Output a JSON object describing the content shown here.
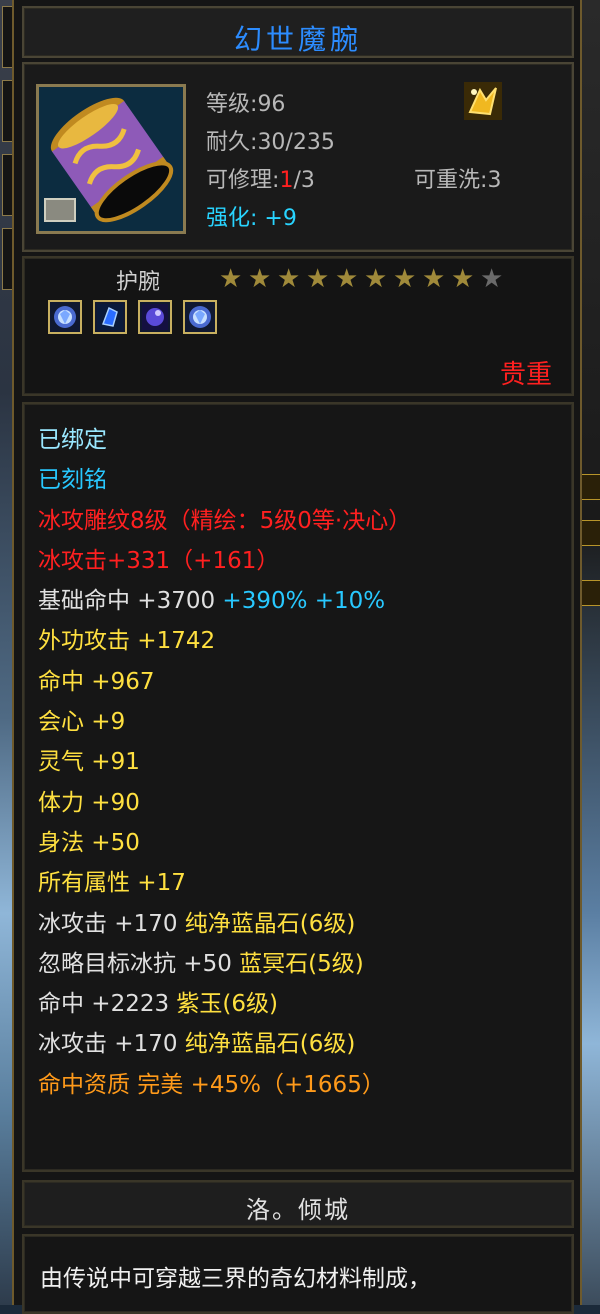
{
  "item": {
    "name": "幻世魔腕",
    "level_label": "等级",
    "level_value": "96",
    "durability_label": "耐久",
    "durability_value": "30/235",
    "repairable_label": "可修理",
    "repairable_current": "1",
    "repairable_total": "/3",
    "rewash_label": "可重洗",
    "rewash_value": "3",
    "enhance_label": "强化",
    "enhance_value": "+9",
    "type": "护腕",
    "stars_filled": 9,
    "stars_total": 10,
    "gems": [
      "ice-gem-icon",
      "blue-crystal-gem-icon",
      "purple-jade-gem-icon",
      "ice-gem-icon"
    ],
    "precious": "贵重"
  },
  "attributes": [
    {
      "text": "已绑定",
      "color": "lightblue"
    },
    {
      "text": "已刻铭",
      "color": "cyan"
    },
    {
      "text": "冰攻雕纹8级（精绘：5级0等·决心）",
      "color": "red"
    },
    {
      "text": "冰攻击+331（+161）",
      "color": "red"
    },
    {
      "text": "基础命中 +3700",
      "extra": " +390% +10%",
      "color": "white",
      "extra_color": "cyan"
    },
    {
      "text": "外功攻击 +1742",
      "color": "yellow"
    },
    {
      "text": "命中 +967",
      "color": "yellow"
    },
    {
      "text": "会心 +9",
      "color": "yellow"
    },
    {
      "text": "灵气 +91",
      "color": "yellow"
    },
    {
      "text": "体力 +90",
      "color": "yellow"
    },
    {
      "text": "身法 +50",
      "color": "yellow"
    },
    {
      "text": "所有属性 +17",
      "color": "yellow"
    },
    {
      "text": "冰攻击 +170",
      "extra": " 纯净蓝晶石(6级)",
      "color": "white",
      "extra_color": "yellow"
    },
    {
      "text": "忽略目标冰抗 +50",
      "extra": " 蓝冥石(5级)",
      "color": "white",
      "extra_color": "yellow"
    },
    {
      "text": "命中 +2223",
      "extra": " 紫玉(6级)",
      "color": "white",
      "extra_color": "yellow"
    },
    {
      "text": "冰攻击 +170",
      "extra": " 纯净蓝晶石(6级)",
      "color": "white",
      "extra_color": "yellow"
    },
    {
      "text": "命中资质 完美",
      "extra": " +45%（+1665）",
      "color": "orange",
      "extra_color": "orange"
    }
  ],
  "maker": "洛。倾城",
  "description": "由传说中可穿越三界的奇幻材料制成，",
  "colors": {
    "title": "#2c8cff",
    "red": "#ff2020",
    "cyan": "#28c8ff",
    "yellow": "#ffe040",
    "orange": "#ff9a1a"
  }
}
